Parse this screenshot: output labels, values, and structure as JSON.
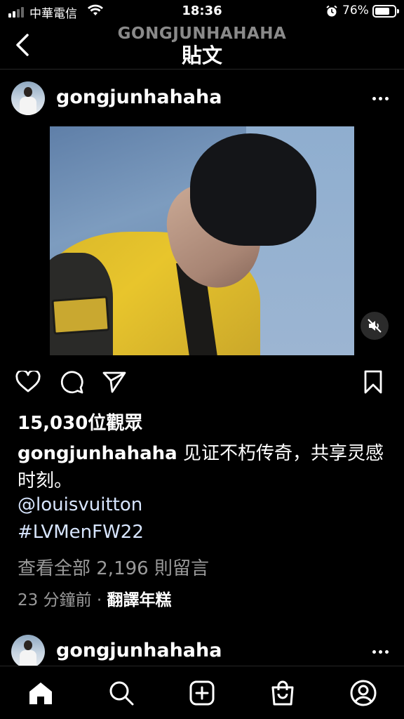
{
  "status_bar": {
    "carrier": "中華電信",
    "time": "18:36",
    "battery": "76%",
    "battery_level": 0.76,
    "icons": [
      "signal-icon",
      "wifi-icon",
      "alarm-icon",
      "battery-icon"
    ]
  },
  "header": {
    "subtitle": "GONGJUNHAHAHA",
    "title": "貼文",
    "back_icon": "chevron-left-icon"
  },
  "post": {
    "username": "gongjunhahaha",
    "more_icon": "ellipsis-icon",
    "media_alt_icon": "mute-icon",
    "views": "15,030位觀眾",
    "caption_user": "gongjunhahaha",
    "caption_text": " 见证不朽传奇，共享灵感时刻。",
    "mention": "@louisvuitton",
    "hashtag": "#LVMenFW22",
    "view_comments": "查看全部 2,196 則留言",
    "time_ago": "23 分鐘前",
    "separator": " · ",
    "translate": "翻譯年糕",
    "actions": [
      "heart-icon",
      "comment-icon",
      "share-icon",
      "bookmark-icon"
    ]
  },
  "next_post": {
    "username": "gongjunhahaha"
  },
  "tabbar": {
    "items": [
      "home-icon",
      "search-icon",
      "create-icon",
      "shop-icon",
      "profile-icon"
    ]
  }
}
